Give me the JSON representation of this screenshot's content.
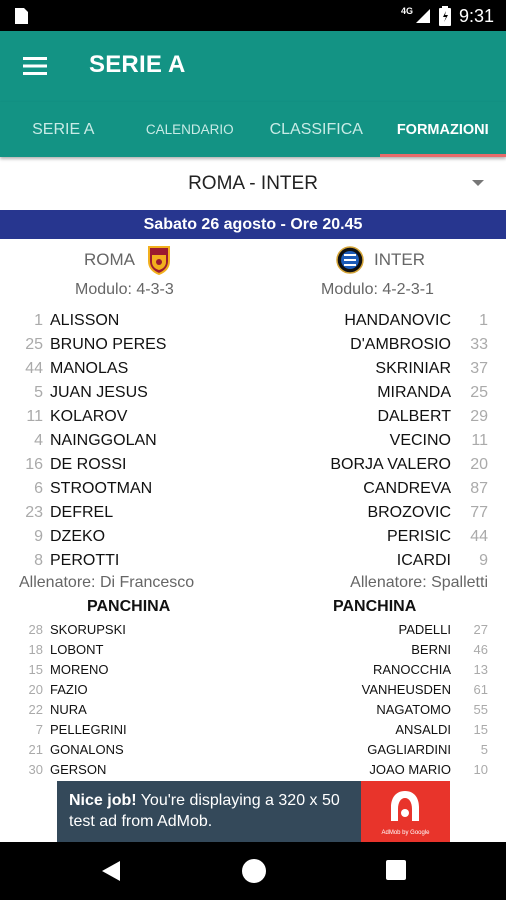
{
  "status_bar": {
    "network": "4G",
    "time": "9:31"
  },
  "app": {
    "title": "SERIE A"
  },
  "tabs": [
    {
      "label": "SERIE A",
      "active": false
    },
    {
      "label": "CALENDARIO",
      "active": false
    },
    {
      "label": "CLASSIFICA",
      "active": false
    },
    {
      "label": "FORMAZIONI",
      "active": true
    }
  ],
  "match_select": {
    "value": "ROMA - INTER"
  },
  "match": {
    "date": "Sabato 26 agosto - Ore 20.45",
    "home": {
      "name": "ROMA",
      "modulo": "Modulo: 4-3-3",
      "coach": "Allenatore: Di Francesco",
      "bench_title": "PANCHINA",
      "starters": [
        {
          "num": "1",
          "name": "ALISSON"
        },
        {
          "num": "25",
          "name": "BRUNO PERES"
        },
        {
          "num": "44",
          "name": "MANOLAS"
        },
        {
          "num": "5",
          "name": "JUAN JESUS"
        },
        {
          "num": "11",
          "name": "KOLAROV"
        },
        {
          "num": "4",
          "name": "NAINGGOLAN"
        },
        {
          "num": "16",
          "name": "DE ROSSI"
        },
        {
          "num": "6",
          "name": "STROOTMAN"
        },
        {
          "num": "23",
          "name": "DEFREL"
        },
        {
          "num": "9",
          "name": "DZEKO"
        },
        {
          "num": "8",
          "name": "PEROTTI"
        }
      ],
      "bench": [
        {
          "num": "28",
          "name": "SKORUPSKI"
        },
        {
          "num": "18",
          "name": "LOBONT"
        },
        {
          "num": "15",
          "name": "MORENO"
        },
        {
          "num": "20",
          "name": "FAZIO"
        },
        {
          "num": "22",
          "name": "NURA"
        },
        {
          "num": "7",
          "name": "PELLEGRINI"
        },
        {
          "num": "21",
          "name": "GONALONS"
        },
        {
          "num": "30",
          "name": "GERSON"
        }
      ]
    },
    "away": {
      "name": "INTER",
      "modulo": "Modulo: 4-2-3-1",
      "coach": "Allenatore: Spalletti",
      "bench_title": "PANCHINA",
      "starters": [
        {
          "num": "1",
          "name": "HANDANOVIC"
        },
        {
          "num": "33",
          "name": "D'AMBROSIO"
        },
        {
          "num": "37",
          "name": "SKRINIAR"
        },
        {
          "num": "25",
          "name": "MIRANDA"
        },
        {
          "num": "29",
          "name": "DALBERT"
        },
        {
          "num": "11",
          "name": "VECINO"
        },
        {
          "num": "20",
          "name": "BORJA VALERO"
        },
        {
          "num": "87",
          "name": "CANDREVA"
        },
        {
          "num": "77",
          "name": "BROZOVIC"
        },
        {
          "num": "44",
          "name": "PERISIC"
        },
        {
          "num": "9",
          "name": "ICARDI"
        }
      ],
      "bench": [
        {
          "num": "27",
          "name": "PADELLI"
        },
        {
          "num": "46",
          "name": "BERNI"
        },
        {
          "num": "13",
          "name": "RANOCCHIA"
        },
        {
          "num": "61",
          "name": "VANHEUSDEN"
        },
        {
          "num": "55",
          "name": "NAGATOMO"
        },
        {
          "num": "15",
          "name": "ANSALDI"
        },
        {
          "num": "5",
          "name": "GAGLIARDINI"
        },
        {
          "num": "10",
          "name": "JOAO MARIO"
        }
      ]
    }
  },
  "ad": {
    "bold": "Nice job!",
    "text": " You're displaying a 320 x 50 test ad from AdMob.",
    "logo_caption": "AdMob by Google"
  },
  "colors": {
    "primary": "#139384",
    "date_bar": "#27368f",
    "tab_indicator": "#e86b6b",
    "ad_bg": "#34495a",
    "ad_logo": "#e8342b"
  },
  "icons": [
    "document-icon",
    "signal-icon",
    "battery-icon",
    "menu-icon",
    "dropdown-icon",
    "roma-crest-icon",
    "inter-crest-icon",
    "back-icon",
    "home-icon",
    "recent-apps-icon"
  ]
}
